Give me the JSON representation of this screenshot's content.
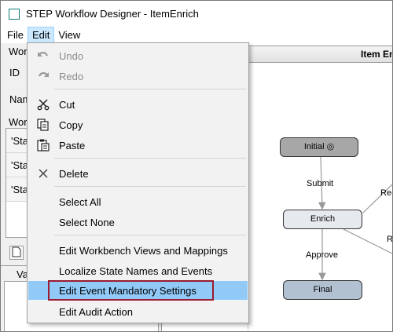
{
  "window": {
    "title": "STEP Workflow Designer - ItemEnrich",
    "accent_color": "#0f7d7a"
  },
  "menubar": {
    "items": [
      "File",
      "Edit",
      "View"
    ],
    "active_index": 1
  },
  "left_panel": {
    "workflow_group_label": "Wor",
    "id_label": "ID",
    "name_label": "Nam",
    "workflow_list_label": "Wor",
    "list_rows": [
      "'Sta",
      "'Sta",
      "'Sta"
    ],
    "va_tab_label": "Va"
  },
  "diagram": {
    "header_title": "Item En",
    "nodes": {
      "initial": "Initial ◎",
      "enrich": "Enrich",
      "final": "Final"
    },
    "edges": {
      "submit": "Submit",
      "approve": "Approve",
      "re_partial": "Re-",
      "r_partial": "R"
    },
    "colors": {
      "initial_node": "#a7a7a7",
      "enrich_node": "#e6e9ee",
      "final_node": "#b1c1d2"
    }
  },
  "edit_menu": {
    "items": {
      "undo": {
        "label": "Undo",
        "icon": "undo-icon",
        "enabled": false
      },
      "redo": {
        "label": "Redo",
        "icon": "redo-icon",
        "enabled": false
      },
      "cut": {
        "label": "Cut",
        "icon": "scissors-icon",
        "enabled": true
      },
      "copy": {
        "label": "Copy",
        "icon": "copy-icon",
        "enabled": true
      },
      "paste": {
        "label": "Paste",
        "icon": "paste-icon",
        "enabled": true
      },
      "delete": {
        "label": "Delete",
        "icon": "delete-x-icon",
        "enabled": true
      },
      "select_all": {
        "label": "Select All",
        "enabled": true
      },
      "select_none": {
        "label": "Select None",
        "enabled": true
      },
      "edit_workbench": {
        "label": "Edit Workbench Views and Mappings",
        "enabled": true
      },
      "localize": {
        "label": "Localize State Names and Events",
        "enabled": true
      },
      "edit_event_mandatory": {
        "label": "Edit Event Mandatory Settings",
        "enabled": true,
        "highlighted": true
      },
      "edit_audit": {
        "label": "Edit Audit Action",
        "enabled": true
      }
    },
    "highlight_color": "#91c9f7",
    "focus_border_color": "#9b1b30"
  }
}
